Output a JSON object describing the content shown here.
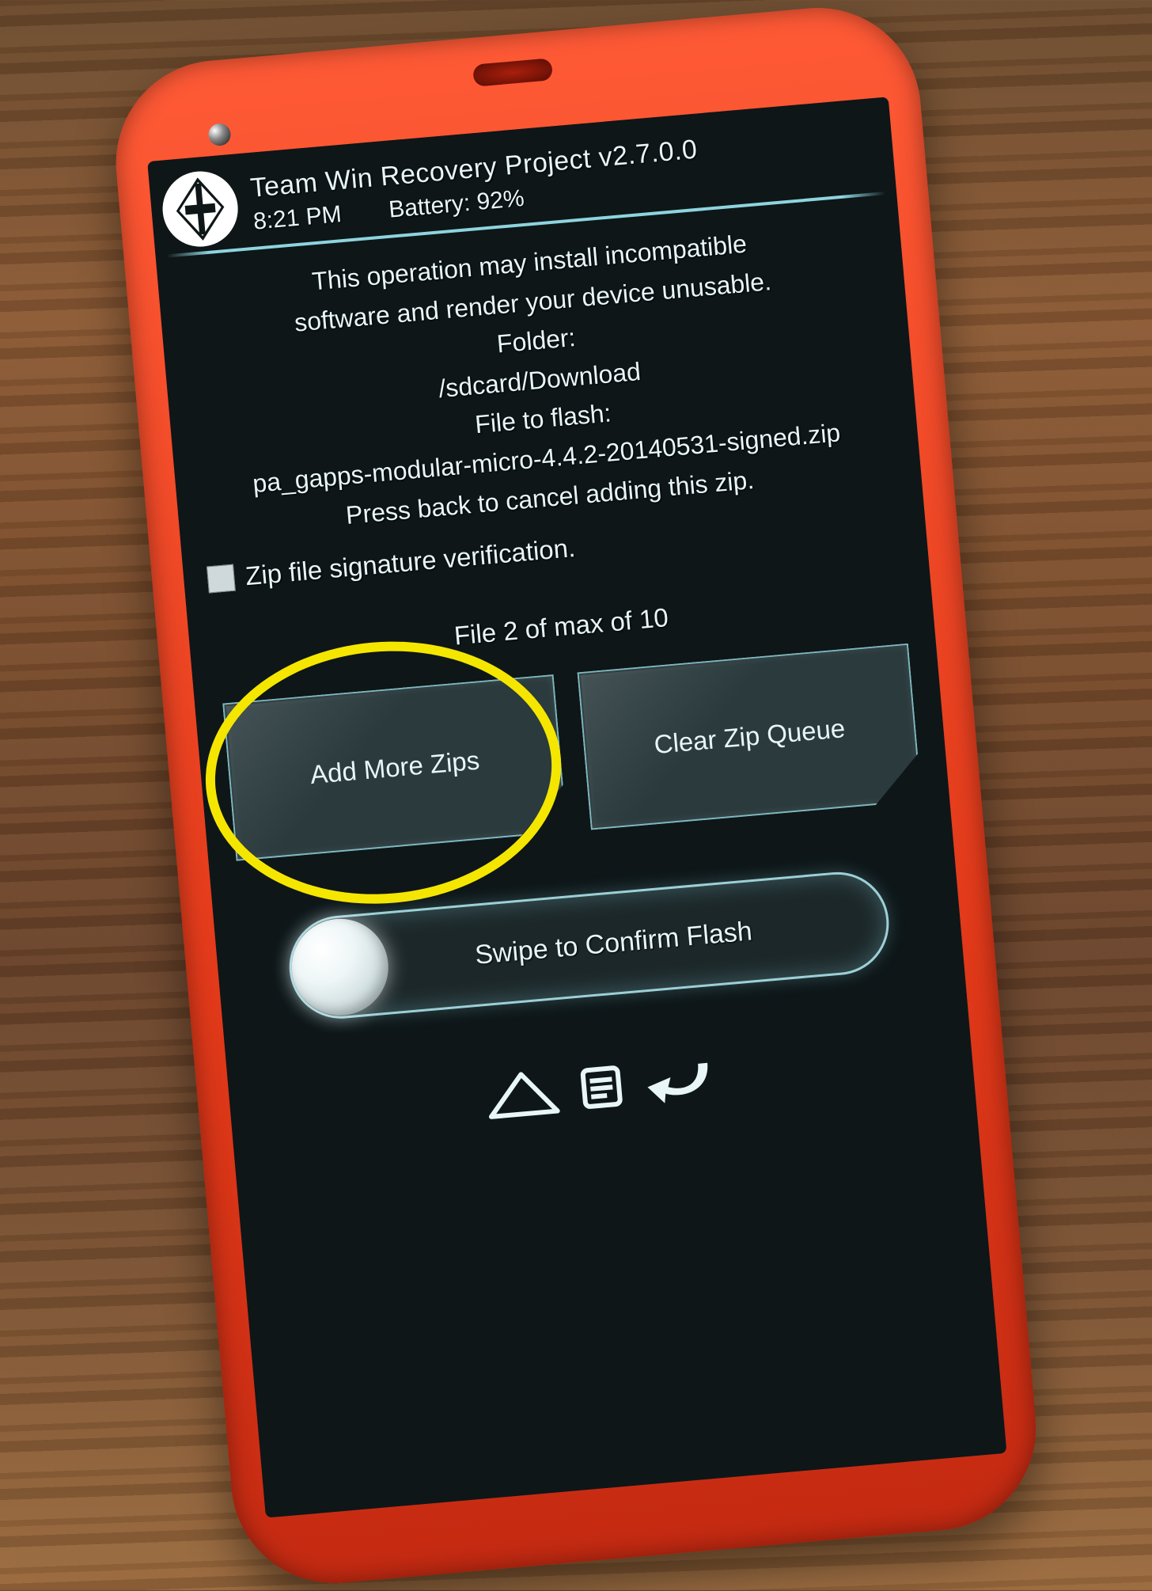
{
  "header": {
    "title": "Team Win Recovery Project  v2.7.0.0",
    "time": "8:21 PM",
    "battery_label": "Battery: 92%"
  },
  "warning_line1": "This operation may install incompatible",
  "warning_line2": "software and render your device unusable.",
  "folder_label": "Folder:",
  "folder_path": "/sdcard/Download",
  "file_label": "File to flash:",
  "file_name": "pa_gapps-modular-micro-4.4.2-20140531-signed.zip",
  "cancel_hint": "Press back to cancel adding this zip.",
  "checkbox_label": "Zip file signature verification.",
  "queue_status": "File 2 of max of 10",
  "buttons": {
    "add_more": "Add More Zips",
    "clear_queue": "Clear Zip Queue"
  },
  "swipe_label": "Swipe to Confirm Flash",
  "annotation": {
    "highlighted_button": "add-more-zips-button",
    "highlight_color": "#f5e600"
  }
}
